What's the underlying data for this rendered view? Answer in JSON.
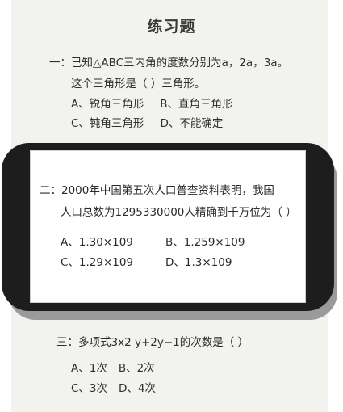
{
  "title": "练习题",
  "q1": {
    "line1": "一：已知△ABC三内角的度数分别为a，2a，3a。",
    "line2": "这个三角形是（    ）三角形。",
    "options": [
      "A、锐角三角形",
      "B、直角三角形",
      "C、钝角三角形",
      "D、不能确定"
    ]
  },
  "q2": {
    "line1": "二：2000年中国第五次人口普查资料表明，我国",
    "line2": "人口总数为1295330000人精确到千万位为（ ）",
    "options": [
      "A、1.30×109",
      "B、1.259×109",
      "C、1.29×109",
      "D、1.3×109"
    ]
  },
  "q3": {
    "line1": "三：多项式3x2 y+2y−1的次数是（    ）",
    "options": [
      "A、1次",
      "B、2次",
      "C、3次",
      "D、4次"
    ]
  }
}
